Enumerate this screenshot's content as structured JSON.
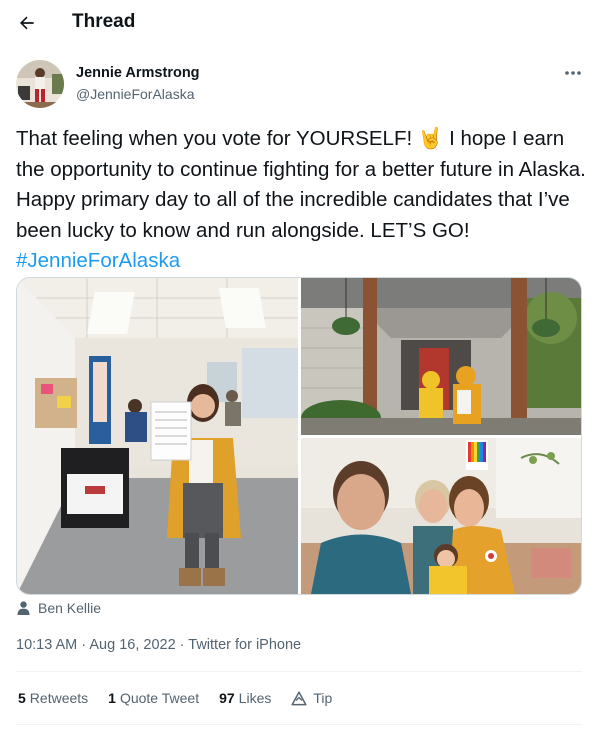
{
  "header": {
    "title": "Thread"
  },
  "author": {
    "name": "Jennie Armstrong",
    "handle": "@JennieForAlaska"
  },
  "tweet": {
    "text": "That feeling when you vote for YOURSELF! 🤘 I hope I earn the opportunity to continue fighting for a better future in Alaska. Happy primary day to all of the incredible candidates that I’ve been lucky to know and run alongside. LET’S GO! ",
    "hashtag": "#JennieForAlaska"
  },
  "tagged_user": "Ben Kellie",
  "meta": {
    "time": "10:13 AM",
    "separator1": " · ",
    "date": "Aug 16, 2022",
    "separator2": " · ",
    "source": "Twitter for iPhone"
  },
  "stats": {
    "retweets_count": "5",
    "retweets_label": "Retweets",
    "quotes_count": "1",
    "quotes_label": "Quote Tweet",
    "likes_count": "97",
    "likes_label": "Likes",
    "tip_label": "Tip"
  },
  "colors": {
    "accent": "#1d9bf0",
    "text_primary": "#0f1419",
    "text_secondary": "#536471",
    "divider": "#eff3f4"
  },
  "icons": {
    "back": "arrow-left-icon",
    "more": "more-horizontal-icon",
    "tagged": "person-icon",
    "tip": "tip-icon"
  }
}
